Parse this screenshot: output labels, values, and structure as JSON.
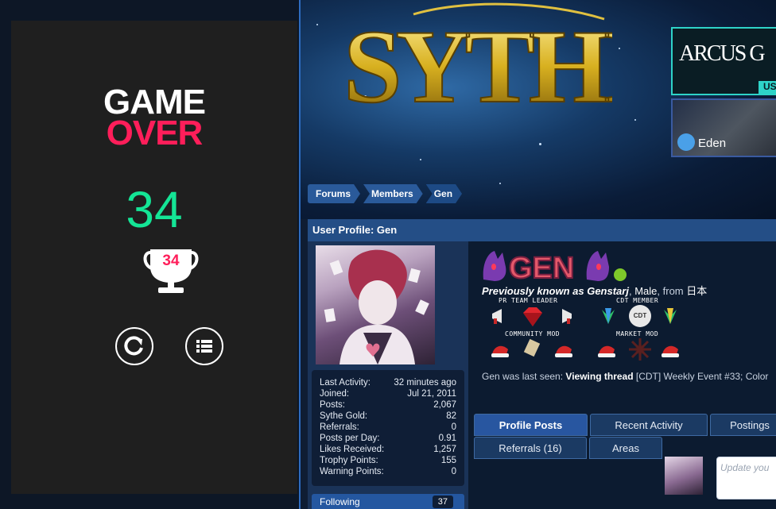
{
  "game": {
    "title_line1": "GAME",
    "title_line2": "OVER",
    "score": "34",
    "trophy_score": "34",
    "colors": {
      "title": "#ffffff",
      "over": "#ff1e5a",
      "score": "#14e596",
      "panel": "#1f1f1f"
    },
    "buttons": [
      {
        "name": "restart",
        "icon": "restart-icon"
      },
      {
        "name": "menu",
        "icon": "list-menu-icon"
      }
    ]
  },
  "site": {
    "logo_text": "SYTHE",
    "ads": {
      "arcus_text": "ARCUS G",
      "arcus_tab": "US",
      "eden_text": "Eden"
    },
    "breadcrumb": [
      "Forums",
      "Members",
      "Gen"
    ],
    "profile_header": "User Profile: Gen",
    "stats": [
      {
        "label": "Last Activity:",
        "value": "32 minutes ago"
      },
      {
        "label": "Joined:",
        "value": "Jul 21, 2011"
      },
      {
        "label": "Posts:",
        "value": "2,067"
      },
      {
        "label": "Sythe Gold:",
        "value": "82"
      },
      {
        "label": "Referrals:",
        "value": "0"
      },
      {
        "label": "Posts per Day:",
        "value": "0.91"
      },
      {
        "label": "Likes Received:",
        "value": "1,257"
      },
      {
        "label": "Trophy Points:",
        "value": "155"
      },
      {
        "label": "Warning Points:",
        "value": "0"
      }
    ],
    "following": {
      "label": "Following",
      "count": "37"
    },
    "username_art": "GEN",
    "known_as": "Previously known as Genstarj",
    "gender": "Male",
    "from_label": "from",
    "location": "日本",
    "badges": {
      "pr_team_leader": "PR TEAM LEADER",
      "cdt_member": "CDT MEMBER",
      "community_mod": "COMMUNITY MOD",
      "market_mod": "MARKET MOD",
      "cdt_icon_text": "CDT"
    },
    "last_seen": {
      "prefix": "Gen was last seen:",
      "action": "Viewing thread",
      "thread": "[CDT] Weekly Event #33; Color"
    },
    "tabs": [
      "Profile Posts",
      "Recent Activity",
      "Postings",
      "Referrals (16)",
      "Areas"
    ],
    "active_tab": "Profile Posts",
    "update_placeholder": "Update you"
  }
}
